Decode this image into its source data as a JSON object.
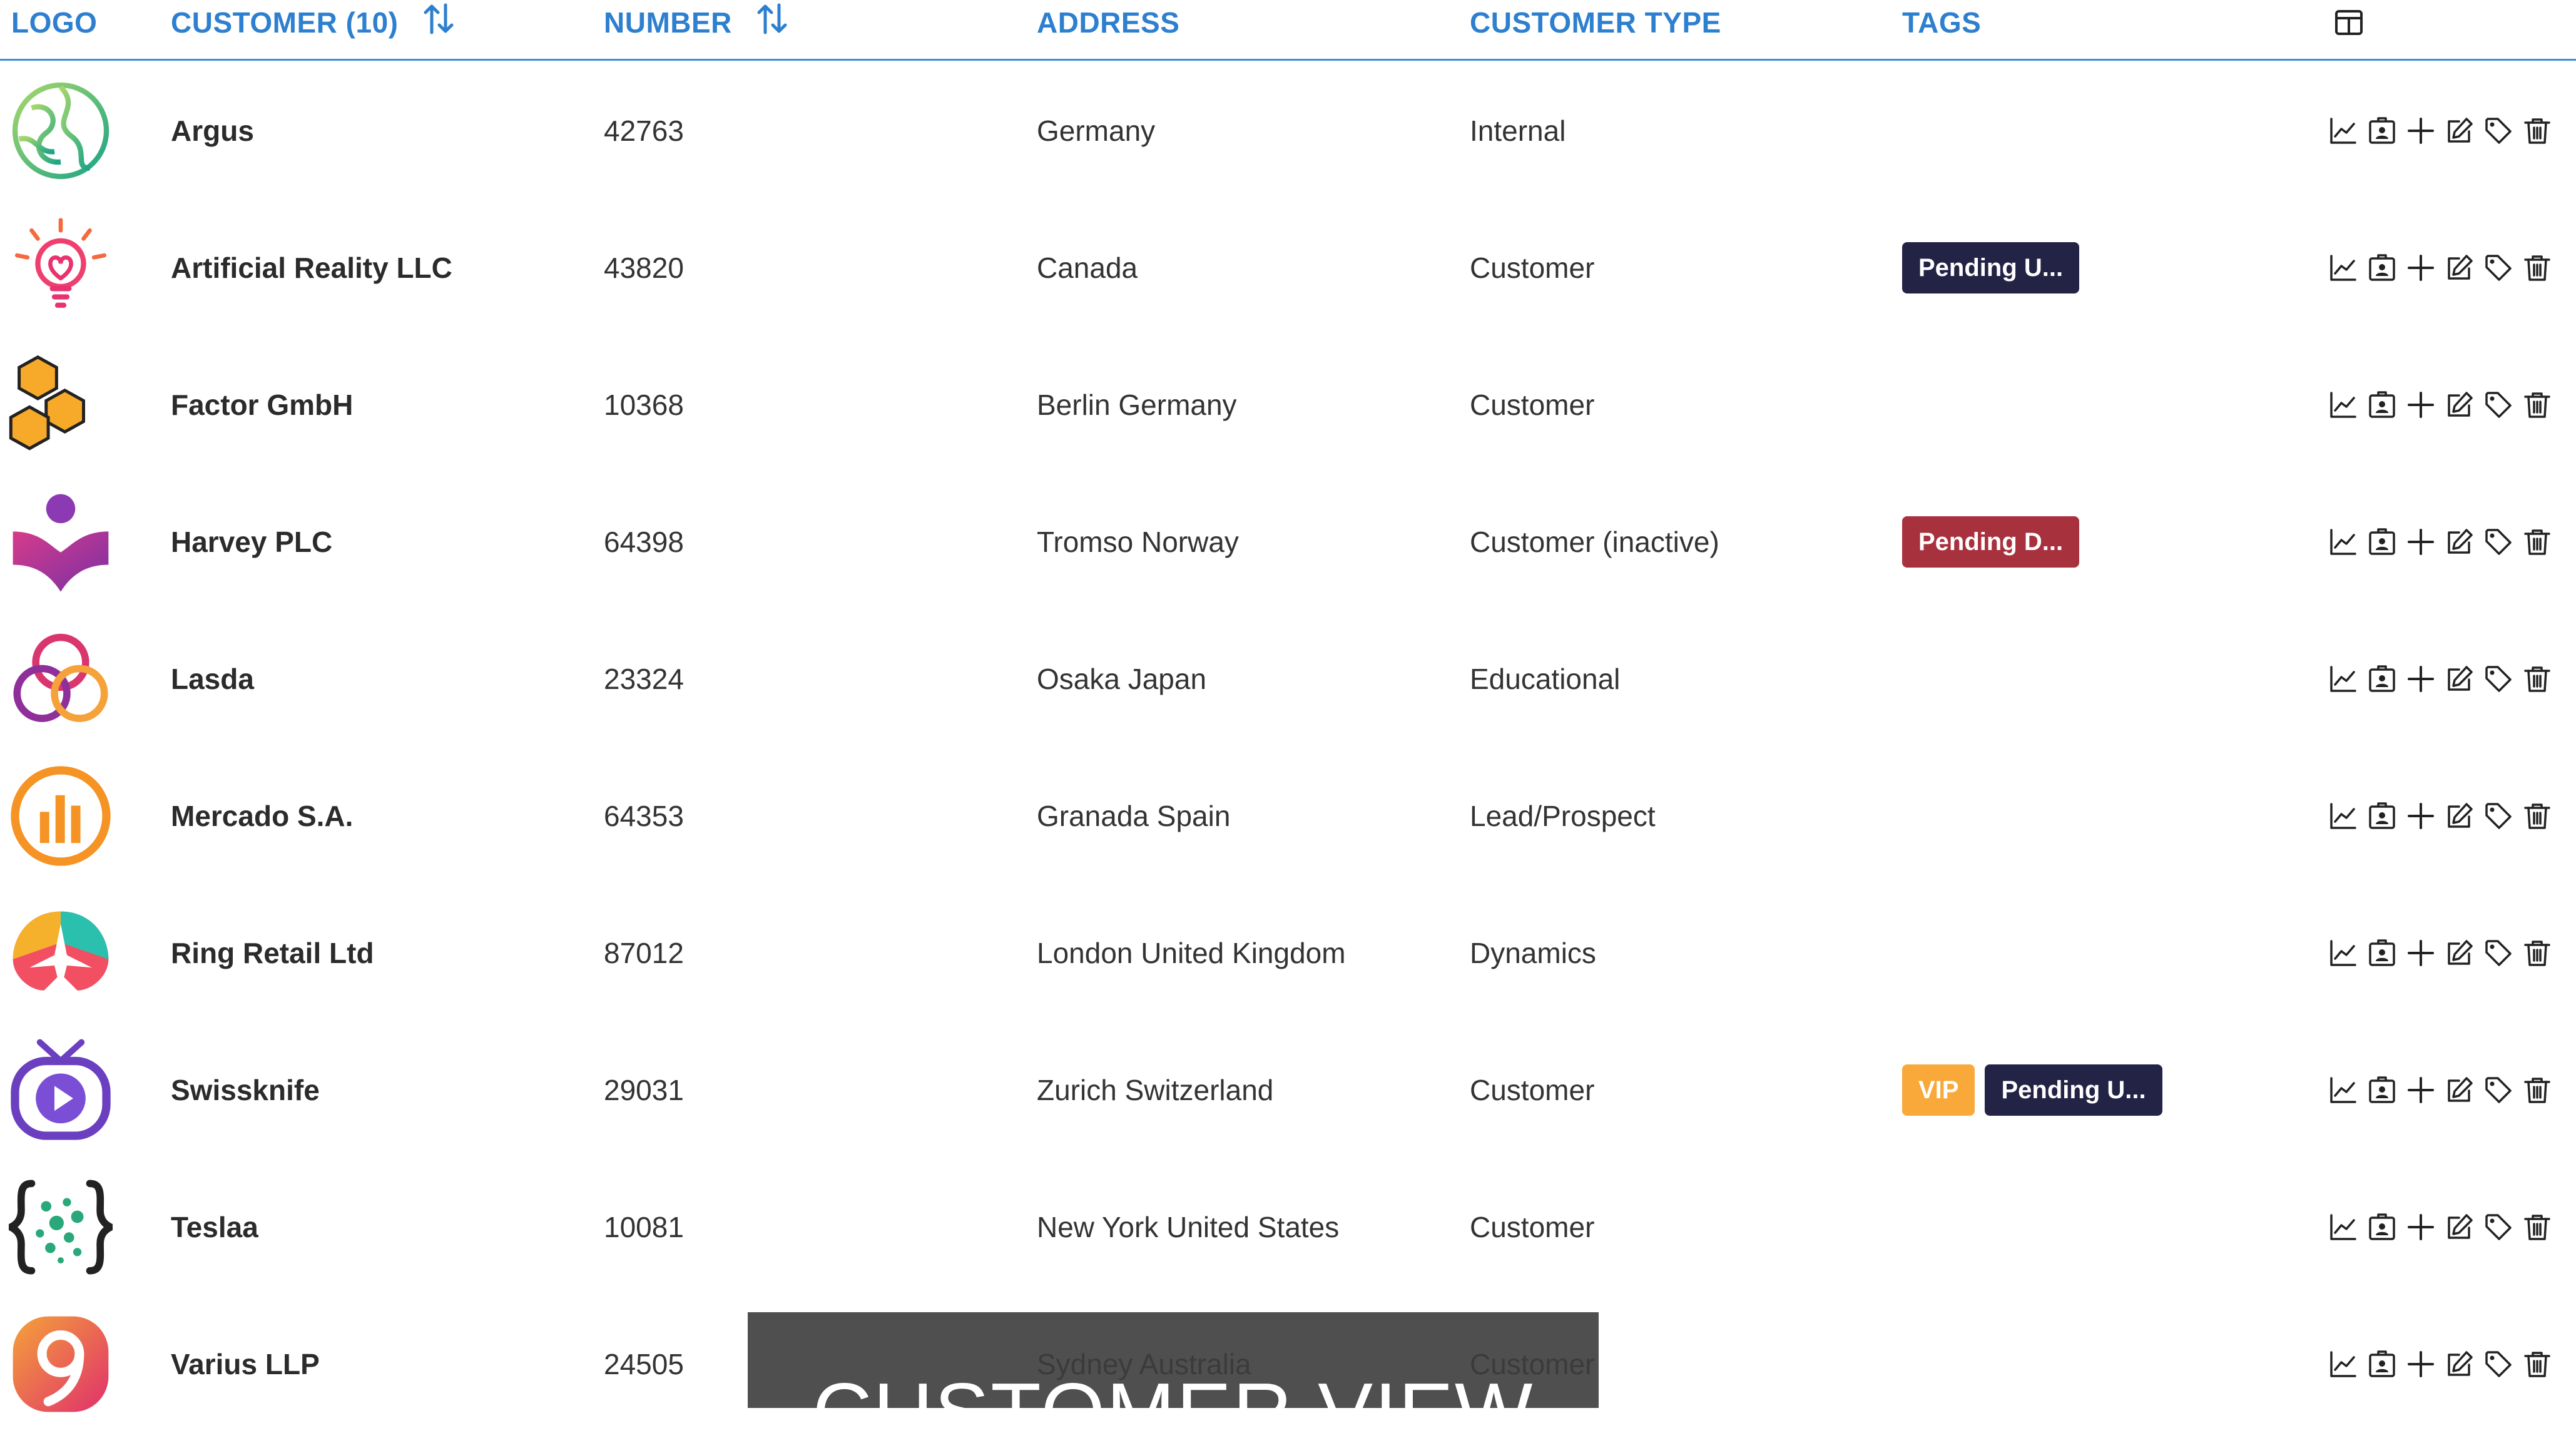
{
  "header": {
    "logo": "LOGO",
    "customer": "CUSTOMER (10)",
    "number": "NUMBER",
    "address": "ADDRESS",
    "customer_type": "CUSTOMER TYPE",
    "tags": "TAGS",
    "columns_icon": "columns-icon",
    "sort_icon": "sort-icon"
  },
  "action_icons": [
    "chart-icon",
    "contact-card-icon",
    "plus-icon",
    "edit-icon",
    "tag-icon",
    "trash-icon"
  ],
  "rows": [
    {
      "name": "Argus",
      "number": "42763",
      "address": "Germany",
      "type": "Internal",
      "tags": [],
      "logo": "argus-logo"
    },
    {
      "name": "Artificial Reality LLC",
      "number": "43820",
      "address": "Canada",
      "type": "Customer",
      "tags": [
        {
          "label": "Pending U...",
          "color": "#232346"
        }
      ],
      "logo": "lightbulb-logo"
    },
    {
      "name": "Factor GmbH",
      "number": "10368",
      "address": "Berlin Germany",
      "type": "Customer",
      "tags": [],
      "logo": "hexagon-logo"
    },
    {
      "name": "Harvey PLC",
      "number": "64398",
      "address": "Tromso Norway",
      "type": "Customer (inactive)",
      "tags": [
        {
          "label": "Pending D...",
          "color": "#a8313e"
        }
      ],
      "logo": "person-logo"
    },
    {
      "name": "Lasda",
      "number": "23324",
      "address": "Osaka Japan",
      "type": "Educational",
      "tags": [],
      "logo": "trefoil-logo"
    },
    {
      "name": "Mercado S.A.",
      "number": "64353",
      "address": "Granada Spain",
      "type": "Lead/Prospect",
      "tags": [],
      "logo": "bars-logo"
    },
    {
      "name": "Ring Retail Ltd",
      "number": "87012",
      "address": "London United Kingdom",
      "type": "Dynamics",
      "tags": [],
      "logo": "plane-logo"
    },
    {
      "name": "Swissknife",
      "number": "29031",
      "address": "Zurich Switzerland",
      "type": "Customer",
      "tags": [
        {
          "label": "VIP",
          "color": "#f8a93a"
        },
        {
          "label": "Pending U...",
          "color": "#232346"
        }
      ],
      "logo": "tv-logo"
    },
    {
      "name": "Teslaa",
      "number": "10081",
      "address": "New York United States",
      "type": "Customer",
      "tags": [],
      "logo": "braces-logo"
    },
    {
      "name": "Varius LLP",
      "number": "24505",
      "address": "Sydney Australia",
      "type": "Customer",
      "tags": [],
      "logo": "nine-logo"
    }
  ],
  "overlay": {
    "title": "CUSTOMER VIEW"
  },
  "colors": {
    "accent": "#2d7fcf",
    "header_border": "#3a8fd9",
    "text": "#333333"
  }
}
